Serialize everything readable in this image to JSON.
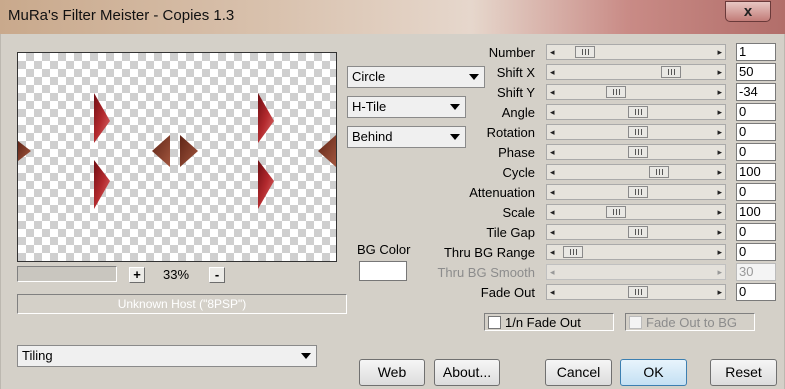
{
  "window": {
    "title": "MuRa's Filter Meister - Copies 1.3",
    "close_glyph": "x"
  },
  "preview": {
    "zoom_minus": "-",
    "zoom_plus": "+",
    "zoom_value": "33%",
    "host_text": "Unknown Host (\"8PSP\")"
  },
  "dropdowns": {
    "mode": "Circle",
    "tile": "H-Tile",
    "layer": "Behind",
    "preset": "Tiling"
  },
  "bg_color": {
    "label": "BG Color",
    "value": "#ffffff"
  },
  "params": [
    {
      "label": "Number",
      "value": "1",
      "level": 0.09,
      "enabled": true
    },
    {
      "label": "Shift X",
      "value": "50",
      "level": 0.75,
      "enabled": true
    },
    {
      "label": "Shift Y",
      "value": "-34",
      "level": 0.33,
      "enabled": true
    },
    {
      "label": "Angle",
      "value": "0",
      "level": 0.5,
      "enabled": true
    },
    {
      "label": "Rotation",
      "value": "0",
      "level": 0.5,
      "enabled": true
    },
    {
      "label": "Phase",
      "value": "0",
      "level": 0.5,
      "enabled": true
    },
    {
      "label": "Cycle",
      "value": "100",
      "level": 0.66,
      "enabled": true
    },
    {
      "label": "Attenuation",
      "value": "0",
      "level": 0.5,
      "enabled": true
    },
    {
      "label": "Scale",
      "value": "100",
      "level": 0.33,
      "enabled": true
    },
    {
      "label": "Tile Gap",
      "value": "0",
      "level": 0.5,
      "enabled": true
    },
    {
      "label": "Thru BG Range",
      "value": "0",
      "level": 0.0,
      "enabled": true
    },
    {
      "label": "Thru BG Smooth",
      "value": "30",
      "level": 0.0,
      "enabled": false
    },
    {
      "label": "Fade Out",
      "value": "0",
      "level": 0.5,
      "enabled": true
    }
  ],
  "checkboxes": {
    "fade_out_inverse": {
      "label": "1/n Fade Out",
      "checked": false,
      "enabled": true
    },
    "fade_out_to_bg": {
      "label": "Fade Out to BG",
      "checked": false,
      "enabled": false
    }
  },
  "buttons": {
    "web": "Web",
    "about": "About...",
    "cancel": "Cancel",
    "ok": "OK",
    "reset": "Reset"
  },
  "scroll_glyphs": {
    "left": "◂",
    "right": "▸"
  },
  "colors": {
    "shape_dark": "#8c1b1f",
    "shape_light": "#c94a4a",
    "shape_brown": "#7a3626"
  }
}
